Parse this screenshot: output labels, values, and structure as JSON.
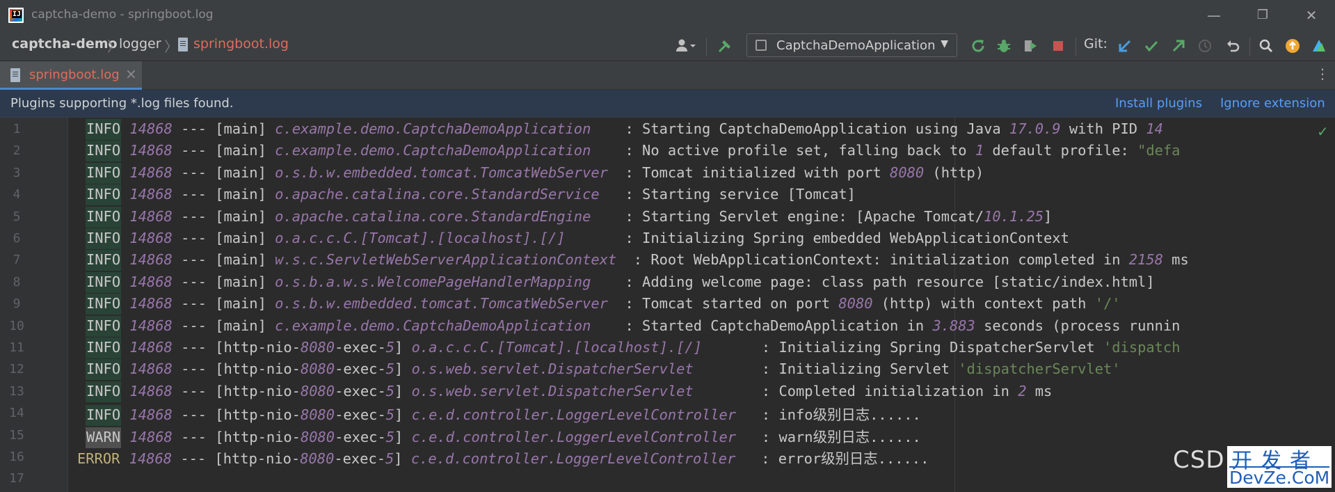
{
  "window": {
    "app_logo_text": "IJ",
    "title": "captcha-demo - springboot.log",
    "controls": {
      "minimize": "—",
      "restore": "❐",
      "close": "✕"
    }
  },
  "navbar": {
    "breadcrumbs": [
      "captcha-demo",
      "logger",
      "springboot.log"
    ],
    "run_config": "CaptchaDemoApplication",
    "git_label": "Git:",
    "icons": [
      "user-icon",
      "build-hammer-icon",
      "rerun-icon",
      "debug-icon",
      "coverage-icon",
      "stop-icon",
      "git-update-icon",
      "git-commit-icon",
      "git-push-icon",
      "history-icon",
      "rollback-icon",
      "search-icon",
      "update-icon",
      "plugin-logo-icon"
    ],
    "colors": {
      "hammer": "#59a869",
      "run": "#59a869",
      "stop": "#c75450",
      "git_update": "#4a9de0",
      "git_commit": "#59a869",
      "git_push": "#59a869",
      "update": "#f0a732"
    }
  },
  "tab": {
    "label": "springboot.log",
    "close": "×",
    "more": "⋮"
  },
  "banner": {
    "text": "Plugins supporting *.log files found.",
    "install": "Install plugins",
    "ignore": "Ignore extension"
  },
  "log_lines": [
    {
      "n": "1",
      "level": "INFO",
      "pid": "14868",
      "sep": "---",
      "thread": "[main]",
      "logger": "c.example.demo.CaptchaDemoApplication   ",
      "msg_a": ": Starting CaptchaDemoApplication using Java ",
      "num1": "17.0.9",
      "msg_b": " with PID ",
      "num2": "14",
      "str": ""
    },
    {
      "n": "2",
      "level": "INFO",
      "pid": "14868",
      "sep": "---",
      "thread": "[main]",
      "logger": "c.example.demo.CaptchaDemoApplication   ",
      "msg_a": ": No active profile set, falling back to ",
      "num1": "1",
      "msg_b": " default profile: ",
      "num2": "",
      "str": "\"defa"
    },
    {
      "n": "3",
      "level": "INFO",
      "pid": "14868",
      "sep": "---",
      "thread": "[main]",
      "logger": "o.s.b.w.embedded.tomcat.TomcatWebServer ",
      "msg_a": ": Tomcat initialized with port ",
      "num1": "8080",
      "msg_b": " (http)",
      "num2": "",
      "str": ""
    },
    {
      "n": "4",
      "level": "INFO",
      "pid": "14868",
      "sep": "---",
      "thread": "[main]",
      "logger": "o.apache.catalina.core.StandardService  ",
      "msg_a": ": Starting service [Tomcat]",
      "num1": "",
      "msg_b": "",
      "num2": "",
      "str": ""
    },
    {
      "n": "5",
      "level": "INFO",
      "pid": "14868",
      "sep": "---",
      "thread": "[main]",
      "logger": "o.apache.catalina.core.StandardEngine   ",
      "msg_a": ": Starting Servlet engine: [Apache Tomcat/",
      "num1": "10.1.25",
      "msg_b": "]",
      "num2": "",
      "str": ""
    },
    {
      "n": "6",
      "level": "INFO",
      "pid": "14868",
      "sep": "---",
      "thread": "[main]",
      "logger": "o.a.c.c.C.[Tomcat].[localhost].[/]      ",
      "msg_a": ": Initializing Spring embedded WebApplicationContext",
      "num1": "",
      "msg_b": "",
      "num2": "",
      "str": ""
    },
    {
      "n": "7",
      "level": "INFO",
      "pid": "14868",
      "sep": "---",
      "thread": "[main]",
      "logger": "w.s.c.ServletWebServerApplicationContext",
      "msg_a": " : Root WebApplicationContext: initialization completed in ",
      "num1": "2158",
      "msg_b": " ms",
      "num2": "",
      "str": ""
    },
    {
      "n": "8",
      "level": "INFO",
      "pid": "14868",
      "sep": "---",
      "thread": "[main]",
      "logger": "o.s.b.a.w.s.WelcomePageHandlerMapping   ",
      "msg_a": ": Adding welcome page: class path resource [static/index.html]",
      "num1": "",
      "msg_b": "",
      "num2": "",
      "str": ""
    },
    {
      "n": "9",
      "level": "INFO",
      "pid": "14868",
      "sep": "---",
      "thread": "[main]",
      "logger": "o.s.b.w.embedded.tomcat.TomcatWebServer ",
      "msg_a": ": Tomcat started on port ",
      "num1": "8080",
      "msg_b": " (http) with context path ",
      "num2": "",
      "str": "'/'"
    },
    {
      "n": "10",
      "level": "INFO",
      "pid": "14868",
      "sep": "---",
      "thread": "[main]",
      "logger": "c.example.demo.CaptchaDemoApplication   ",
      "msg_a": ": Started CaptchaDemoApplication in ",
      "num1": "3.883",
      "msg_b": " seconds (process runnin",
      "num2": "",
      "str": ""
    },
    {
      "n": "11",
      "level": "INFO",
      "pid": "14868",
      "sep": "---",
      "thread_a": "[http-nio-",
      "thread_num": "8080",
      "thread_b": "-exec-",
      "thread_num2": "5",
      "thread_c": "]",
      "logger": "o.a.c.c.C.[Tomcat].[localhost].[/]      ",
      "msg_a": ": Initializing Spring DispatcherServlet ",
      "num1": "",
      "msg_b": "",
      "num2": "",
      "str": "'dispatch"
    },
    {
      "n": "12",
      "level": "INFO",
      "pid": "14868",
      "sep": "---",
      "thread_a": "[http-nio-",
      "thread_num": "8080",
      "thread_b": "-exec-",
      "thread_num2": "5",
      "thread_c": "]",
      "logger": "o.s.web.servlet.DispatcherServlet       ",
      "msg_a": ": Initializing Servlet ",
      "num1": "",
      "msg_b": "",
      "num2": "",
      "str": "'dispatcherServlet'"
    },
    {
      "n": "13",
      "level": "INFO",
      "pid": "14868",
      "sep": "---",
      "thread_a": "[http-nio-",
      "thread_num": "8080",
      "thread_b": "-exec-",
      "thread_num2": "5",
      "thread_c": "]",
      "logger": "o.s.web.servlet.DispatcherServlet       ",
      "msg_a": ": Completed initialization in ",
      "num1": "2",
      "msg_b": " ms",
      "num2": "",
      "str": ""
    },
    {
      "n": "14",
      "level": "INFO",
      "pid": "14868",
      "sep": "---",
      "thread_a": "[http-nio-",
      "thread_num": "8080",
      "thread_b": "-exec-",
      "thread_num2": "5",
      "thread_c": "]",
      "logger": "c.e.d.controller.LoggerLevelController  ",
      "msg_a": ": info级别日志......",
      "num1": "",
      "msg_b": "",
      "num2": "",
      "str": ""
    },
    {
      "n": "15",
      "level": "WARN",
      "pid": "14868",
      "sep": "---",
      "thread_a": "[http-nio-",
      "thread_num": "8080",
      "thread_b": "-exec-",
      "thread_num2": "5",
      "thread_c": "]",
      "logger": "c.e.d.controller.LoggerLevelController  ",
      "msg_a": ": warn级别日志......",
      "num1": "",
      "msg_b": "",
      "num2": "",
      "str": ""
    },
    {
      "n": "16",
      "level": "ERROR",
      "pid": "14868",
      "sep": "---",
      "thread_a": "[http-nio-",
      "thread_num": "8080",
      "thread_b": "-exec-",
      "thread_num2": "5",
      "thread_c": "]",
      "logger": "c.e.d.controller.LoggerLevelController  ",
      "msg_a": ": error级别日志......",
      "num1": "",
      "msg_b": "",
      "num2": "",
      "str": ""
    },
    {
      "n": "17"
    }
  ],
  "watermark": {
    "left": "CSD",
    "top": "开发者",
    "bottom": "DevZe.CoM"
  },
  "status": {
    "inspection": "✓"
  }
}
